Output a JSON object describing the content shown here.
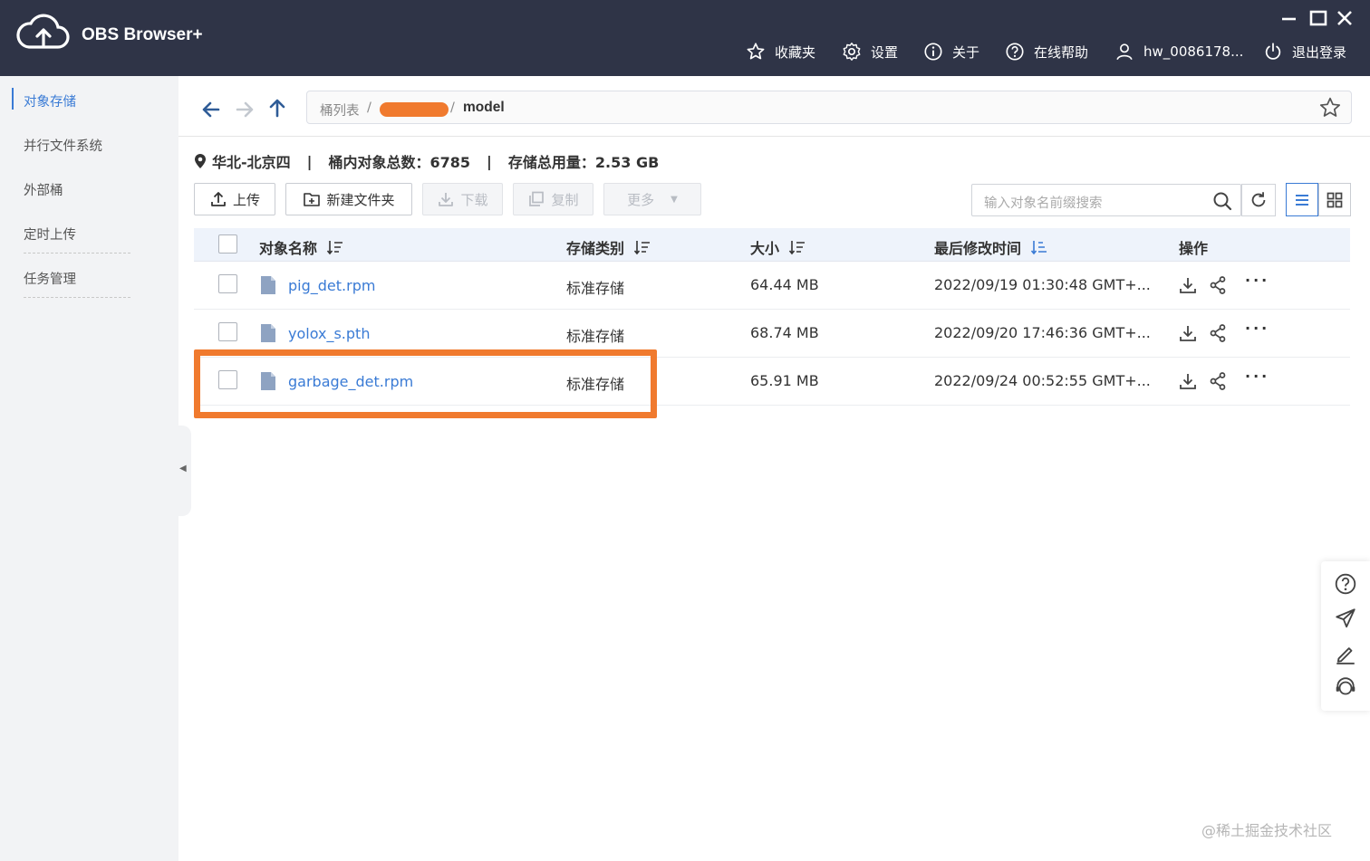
{
  "app": {
    "title": "OBS Browser+",
    "accent_color": "#3a7bd5",
    "titlebar_color": "#2f3447",
    "highlight_color": "#f07a2e"
  },
  "topnav": {
    "favorites": "收藏夹",
    "settings": "设置",
    "about": "关于",
    "help": "在线帮助",
    "user": "hw_0086178...",
    "logout": "退出登录"
  },
  "sidebar": {
    "items": [
      {
        "label": "对象存储",
        "active": true
      },
      {
        "label": "并行文件系统",
        "active": false
      },
      {
        "label": "外部桶",
        "active": false
      },
      {
        "label": "定时上传",
        "active": false
      },
      {
        "label": "任务管理",
        "active": false
      }
    ]
  },
  "breadcrumb": {
    "root": "桶列表",
    "sep": "/",
    "current": "model"
  },
  "info": {
    "region": "华北-北京四",
    "object_count": "桶内对象总数：6785",
    "storage_used": "存储总用量：2.53 GB"
  },
  "toolbar": {
    "upload": "上传",
    "new_folder": "新建文件夹",
    "download": "下载",
    "copy": "复制",
    "more": "更多"
  },
  "search": {
    "placeholder": "输入对象名前缀搜索"
  },
  "table": {
    "headers": {
      "name": "对象名称",
      "storage_class": "存储类别",
      "size": "大小",
      "modified": "最后修改时间",
      "actions": "操作"
    },
    "rows": [
      {
        "name": "pig_det.rpm",
        "storage_class": "标准存储",
        "size": "64.44 MB",
        "modified": "2022/09/19 01:30:48 GMT+..."
      },
      {
        "name": "yolox_s.pth",
        "storage_class": "标准存储",
        "size": "68.74 MB",
        "modified": "2022/09/20 17:46:36 GMT+..."
      },
      {
        "name": "garbage_det.rpm",
        "storage_class": "标准存储",
        "size": "65.91 MB",
        "modified": "2022/09/24 00:52:55 GMT+..."
      }
    ]
  },
  "watermark": "@稀土掘金技术社区"
}
